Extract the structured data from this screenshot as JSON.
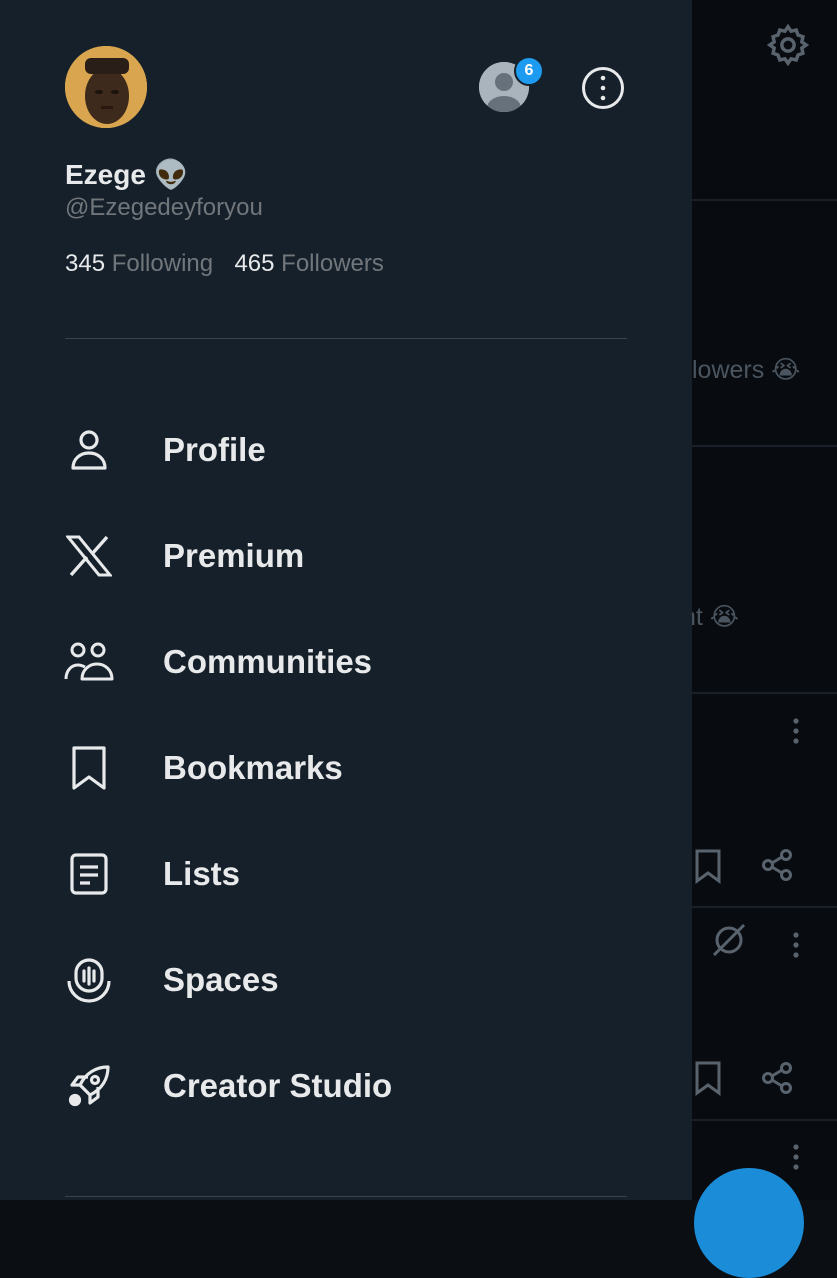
{
  "profile": {
    "name": "Ezege",
    "name_emoji": "👽",
    "handle": "@Ezegedeyforyou",
    "following_count": "345",
    "following_label": "Following",
    "followers_count": "465",
    "followers_label": "Followers"
  },
  "account_switcher": {
    "badge_count": "6"
  },
  "menu": {
    "items": [
      {
        "label": "Profile",
        "icon": "person-icon"
      },
      {
        "label": "Premium",
        "icon": "x-logo-icon"
      },
      {
        "label": "Communities",
        "icon": "communities-icon"
      },
      {
        "label": "Bookmarks",
        "icon": "bookmark-icon"
      },
      {
        "label": "Lists",
        "icon": "list-icon"
      },
      {
        "label": "Spaces",
        "icon": "spaces-icon"
      },
      {
        "label": "Creator Studio",
        "icon": "rocket-icon"
      }
    ]
  },
  "background": {
    "snippet_1": "lowers 😭",
    "snippet_2": "nt 😭"
  },
  "colors": {
    "drawer_bg": "#16202a",
    "text_primary": "#e7e9ea",
    "text_secondary": "#71767b",
    "accent": "#1d9bf0"
  }
}
